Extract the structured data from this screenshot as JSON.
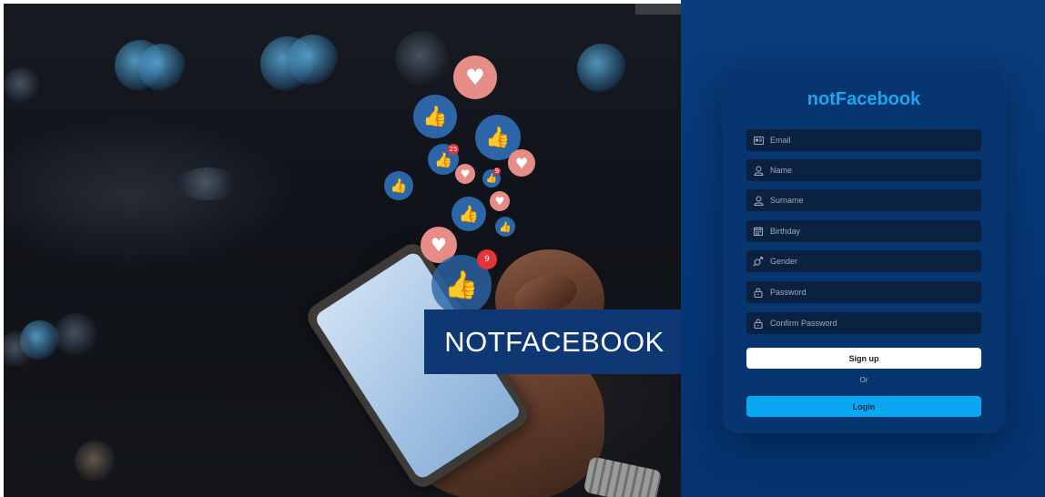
{
  "hero": {
    "banner_text": "NOTFACEBOOK",
    "notification_badges": [
      "25",
      "9",
      "9"
    ]
  },
  "card": {
    "title": "notFacebook",
    "fields": [
      {
        "placeholder": "Email",
        "icon": "id-card-icon"
      },
      {
        "placeholder": "Name",
        "icon": "user-icon"
      },
      {
        "placeholder": "Surname",
        "icon": "user-icon"
      },
      {
        "placeholder": "Birthday",
        "icon": "calendar-icon"
      },
      {
        "placeholder": "Gender",
        "icon": "gender-icon"
      },
      {
        "placeholder": "Password",
        "icon": "lock-icon"
      },
      {
        "placeholder": "Confirm Password",
        "icon": "lock-icon"
      }
    ],
    "signup_label": "Sign up",
    "or_label": "Or",
    "login_label": "Login"
  },
  "colors": {
    "panel_bg": "#063878",
    "card_bg": "#06356f",
    "title": "#19a6f2",
    "field_bg": "#0a2240",
    "login_button": "#0aa7f2",
    "banner_bg": "#0e3774"
  }
}
